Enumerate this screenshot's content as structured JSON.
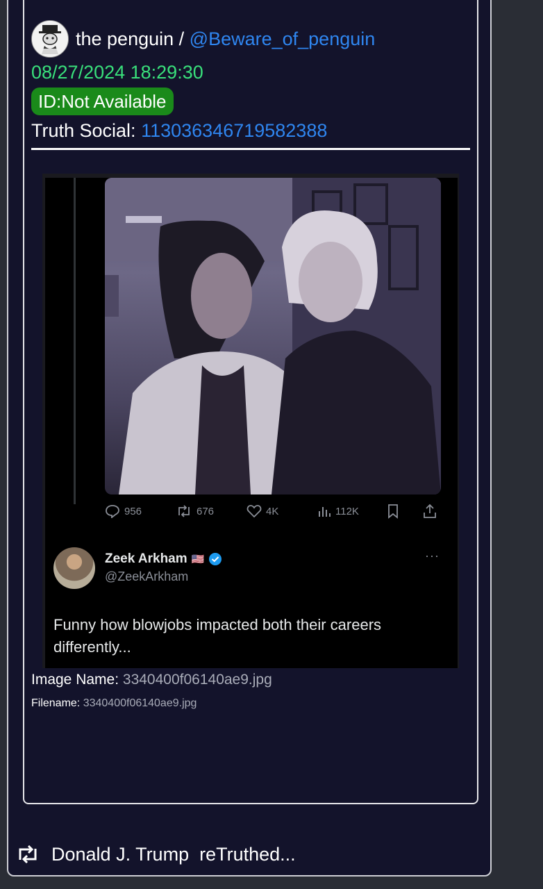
{
  "post": {
    "author_name": "the penguin",
    "separator": " / ",
    "handle": "@Beware_of_penguin",
    "avatar_text": "THE PENGUIN",
    "timestamp": "08/27/2024 18:29:30",
    "id_badge": "ID:Not Available",
    "truth_social_label": "Truth Social: ",
    "truth_social_id": "113036346719582388"
  },
  "embedded_tweet": {
    "stats": {
      "replies": "956",
      "reposts": "676",
      "likes": "4K",
      "views": "112K"
    },
    "author": {
      "name": "Zeek Arkham",
      "flag": "🇺🇸",
      "handle": "@ZeekArkham",
      "more": "···"
    },
    "text": "Funny how blowjobs impacted both their careers differently..."
  },
  "image_meta": {
    "image_name_label": "Image Name: ",
    "image_name": "3340400f06140ae9.jpg",
    "filename_label": "Filename: ",
    "filename": "3340400f06140ae9.jpg"
  },
  "retruth": {
    "text": "Donald J. Trump  reTruthed..."
  },
  "colors": {
    "background": "#13132b",
    "link": "#2f86f0",
    "timestamp": "#39e07b",
    "badge": "#1a8a1a"
  }
}
